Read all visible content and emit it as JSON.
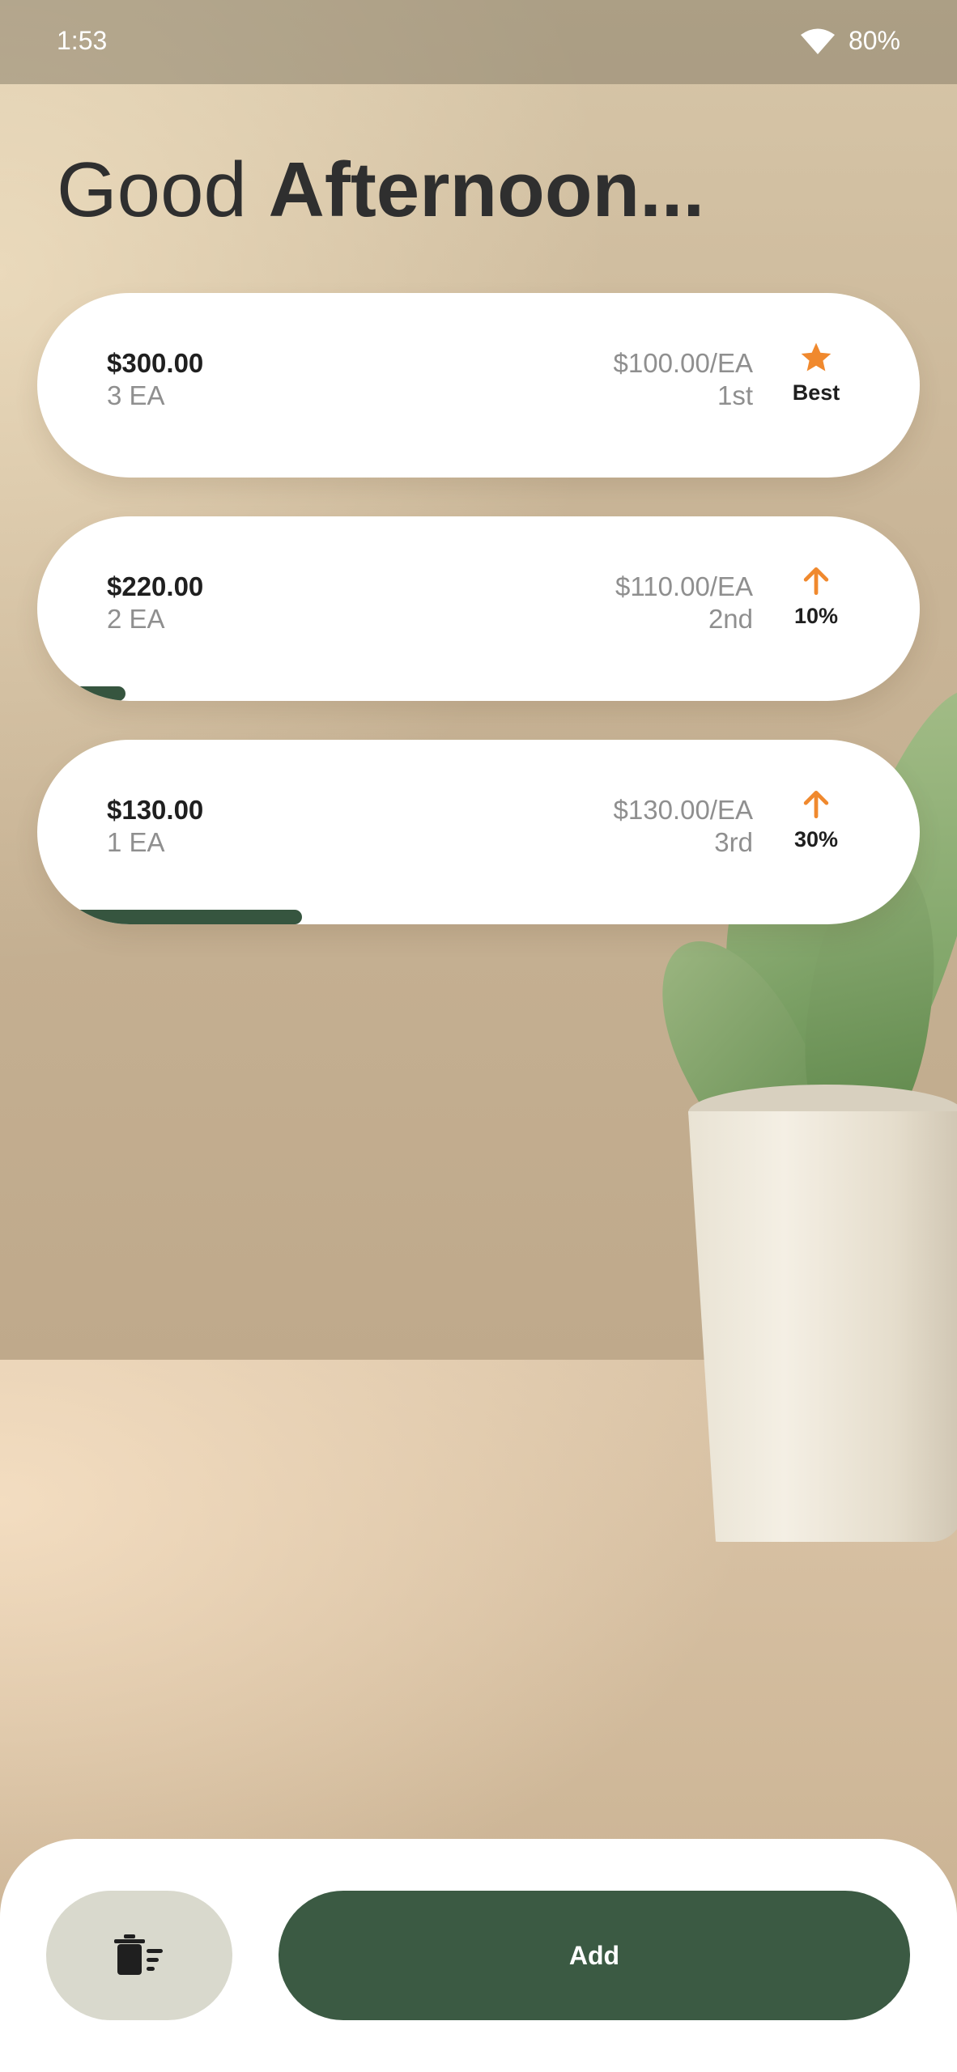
{
  "status_bar": {
    "time": "1:53",
    "battery": "80%"
  },
  "greeting": {
    "prefix": "Good",
    "emphasis": "Afternoon..."
  },
  "items": [
    {
      "total": "$300.00",
      "quantity": "3 EA",
      "unit_price": "$100.00/EA",
      "rank": "1st",
      "badge": "Best",
      "badge_icon": "star-icon",
      "progress_percent": 0
    },
    {
      "total": "$220.00",
      "quantity": "2 EA",
      "unit_price": "$110.00/EA",
      "rank": "2nd",
      "badge": "10%",
      "badge_icon": "arrow-up-icon",
      "progress_percent": 10
    },
    {
      "total": "$130.00",
      "quantity": "1 EA",
      "unit_price": "$130.00/EA",
      "rank": "3rd",
      "badge": "30%",
      "badge_icon": "arrow-up-icon",
      "progress_percent": 30
    }
  ],
  "actions": {
    "clear_icon": "clear-all-icon",
    "add_label": "Add"
  },
  "colors": {
    "accent": "#3b5a43",
    "badge": "#f0892e",
    "muted_text": "#8f8f8f"
  }
}
